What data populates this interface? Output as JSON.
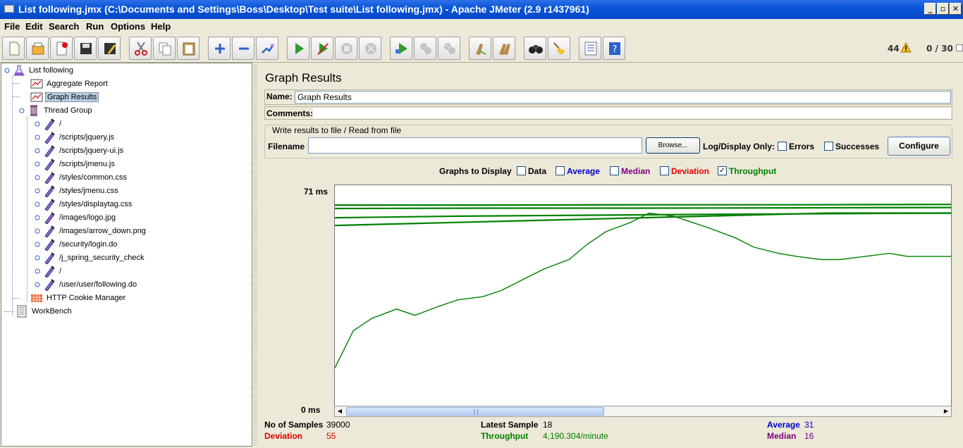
{
  "window": {
    "title": "List following.jmx (C:\\Documents and Settings\\Boss\\Desktop\\Test suite\\List following.jmx) - Apache JMeter (2.9 r1437961)",
    "controls": [
      "minimize-icon",
      "restore-icon",
      "close-icon"
    ]
  },
  "menu": {
    "file": "File",
    "edit": "Edit",
    "search": "Search",
    "run": "Run",
    "options": "Options",
    "help": "Help"
  },
  "toolbar": {
    "icons": [
      "new-icon",
      "open-templates-icon",
      "close-plan-icon",
      "save-icon",
      "save-as-icon",
      "cut-icon",
      "copy-icon",
      "paste-icon",
      "expand-all-icon",
      "collapse-all-icon",
      "toggle-icon",
      "start-icon",
      "start-no-pauses-icon",
      "stop-icon",
      "shutdown-icon",
      "remote-start-all-icon",
      "remote-stop-all-icon",
      "remote-shutdown-all-icon",
      "clear-icon",
      "clear-all-icon",
      "search-icon",
      "reset-search-icon",
      "function-helper-icon",
      "help-icon"
    ],
    "warning_count": "44",
    "thread_count": "0 / 30",
    "colors": {
      "start": "#2f9a2f",
      "disabled": "#b8b8b8",
      "accent_blue": "#2a62c9"
    }
  },
  "tree": {
    "root": "List following",
    "aggregate_report": "Aggregate Report",
    "graph_results": "Graph Results",
    "thread_group": "Thread Group",
    "samplers": [
      "/",
      "/scripts/jquery.js",
      "/scripts/jquery-ui.js",
      "/scripts/jmenu.js",
      "/styles/common.css",
      "/styles/jmenu.css",
      "/styles/displaytag.css",
      "/images/logo.jpg",
      "/images/arrow_down.png",
      "/security/login.do",
      "/j_spring_security_check",
      "/",
      "/user/user/following.do"
    ],
    "cookie_manager": "HTTP Cookie Manager",
    "workbench": "WorkBench",
    "selected": "Graph Results"
  },
  "panel": {
    "title": "Graph Results",
    "name_label": "Name:",
    "name_value": "Graph Results",
    "comments_label": "Comments:",
    "comments_value": "",
    "file_section_title": "Write results to file / Read from file",
    "filename_label": "Filename",
    "filename_value": "",
    "browse_button": "Browse...",
    "log_display_label": "Log/Display Only:",
    "errors_label": "Errors",
    "errors_checked": false,
    "successes_label": "Successes",
    "successes_checked": false,
    "configure_button": "Configure"
  },
  "graph_options": {
    "label": "Graphs to Display",
    "items": [
      {
        "label": "Data",
        "checked": false,
        "color": "#000000"
      },
      {
        "label": "Average",
        "checked": false,
        "color": "#0000cc"
      },
      {
        "label": "Median",
        "checked": false,
        "color": "#800080"
      },
      {
        "label": "Deviation",
        "checked": false,
        "color": "#e00000"
      },
      {
        "label": "Throughput",
        "checked": true,
        "color": "#008000"
      }
    ]
  },
  "chart_data": {
    "type": "line",
    "y_max_label": "71  ms",
    "y_min_label": "0  ms",
    "ylim": [
      0,
      71
    ],
    "series": [
      {
        "color": "#008000",
        "x": [
          0,
          3,
          6,
          10,
          13,
          17,
          20,
          24,
          27,
          31,
          34,
          38,
          41,
          44,
          48,
          51,
          55,
          58,
          61,
          65,
          68,
          72,
          75,
          79,
          82,
          86,
          90,
          93,
          100
        ],
        "values": [
          12,
          24,
          28,
          31,
          29,
          32,
          34,
          35,
          37,
          41,
          44,
          47,
          52,
          56,
          59,
          62,
          61,
          59,
          57,
          54,
          51,
          49,
          48,
          47,
          47,
          48,
          49,
          48,
          48
        ]
      },
      {
        "color": "#008000",
        "x": [
          0,
          10,
          20,
          30,
          40,
          50,
          60,
          70,
          80,
          90,
          100
        ],
        "values": [
          58,
          58.5,
          59,
          59.5,
          60,
          60.5,
          61,
          61.5,
          62,
          62,
          62
        ]
      },
      {
        "color": "#008000",
        "x": [
          0,
          20,
          40,
          60,
          80,
          100
        ],
        "values": [
          60.5,
          61,
          61.3,
          61.6,
          61.8,
          62
        ]
      },
      {
        "color": "#008000",
        "x": [
          0,
          25,
          50,
          75,
          100
        ],
        "values": [
          63.5,
          63.6,
          63.6,
          63.7,
          63.8
        ]
      },
      {
        "color": "#008000",
        "x": [
          0,
          25,
          50,
          75,
          100
        ],
        "values": [
          64.6,
          64.6,
          64.7,
          64.7,
          64.8
        ]
      }
    ]
  },
  "stats": {
    "samples_label": "No of Samples",
    "samples_value": "39000",
    "latest_label": "Latest Sample",
    "latest_value": "18",
    "average_label": "Average",
    "average_value": "31",
    "deviation_label": "Deviation",
    "deviation_value": "55",
    "throughput_label": "Throughput",
    "throughput_value": "4,190.304/minute",
    "median_label": "Median",
    "median_value": "16",
    "colors": {
      "deviation": "#e00000",
      "throughput": "#008000",
      "average": "#0000cc",
      "median": "#800080"
    }
  }
}
